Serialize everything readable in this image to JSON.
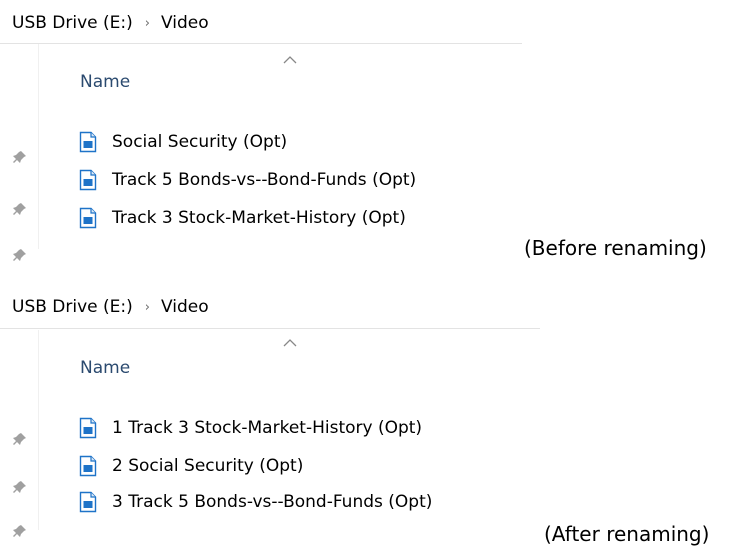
{
  "before": {
    "breadcrumb": [
      "USB Drive (E:)",
      "Video"
    ],
    "breadcrumb_separator": "›",
    "column_header": "Name",
    "files": [
      "Social Security (Opt)",
      "Track 5 Bonds-vs--Bond-Funds (Opt)",
      "Track 3 Stock-Market-History (Opt)"
    ],
    "caption": "(Before renaming)"
  },
  "after": {
    "breadcrumb": [
      "USB Drive (E:)",
      "Video"
    ],
    "breadcrumb_separator": "›",
    "column_header": "Name",
    "files": [
      "1 Track 3 Stock-Market-History (Opt)",
      "2 Social Security (Opt)",
      "3 Track 5 Bonds-vs--Bond-Funds (Opt)"
    ],
    "caption": "(After renaming)"
  },
  "icons": {
    "file": "document-file-icon",
    "pin": "pin-icon",
    "sort": "sort-ascending-icon"
  },
  "colors": {
    "header_text": "#2b4a6f",
    "icon_blue": "#1e73c8",
    "divider": "#e3e3e3"
  }
}
